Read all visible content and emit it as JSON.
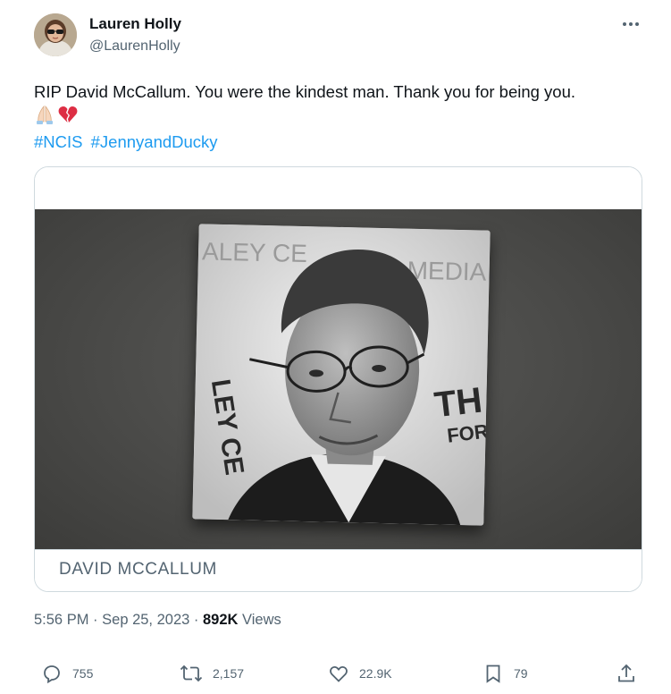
{
  "author": {
    "name": "Lauren Holly",
    "handle": "@LaurenHolly"
  },
  "tweet": {
    "text": "RIP David McCallum. You were the kindest man. Thank you for being you.",
    "emojis": [
      "praying-hands-emoji",
      "broken-heart-emoji"
    ],
    "hashtags": [
      "#NCIS",
      "#JennyandDucky"
    ]
  },
  "card": {
    "title": "DAVID MCCALLUM",
    "photo_sign_text": {
      "top_left": "ALEY CE",
      "top_right": "MEDIA",
      "left_side": "LEY CE",
      "right_side_1": "TH",
      "right_side_2": "FOR"
    }
  },
  "meta": {
    "time": "5:56 PM",
    "separator": "·",
    "date": "Sep 25, 2023",
    "views_count": "892K",
    "views_label": "Views"
  },
  "actions": {
    "replies": "755",
    "reposts": "2,157",
    "likes": "22.9K",
    "bookmarks": "79"
  },
  "icons": [
    "more-options-icon",
    "reply-icon",
    "repost-icon",
    "like-icon",
    "bookmark-icon",
    "share-icon"
  ],
  "colors": {
    "text": "#0f1419",
    "secondary": "#536471",
    "link": "#1d9bf0",
    "border": "#cfd9de"
  }
}
